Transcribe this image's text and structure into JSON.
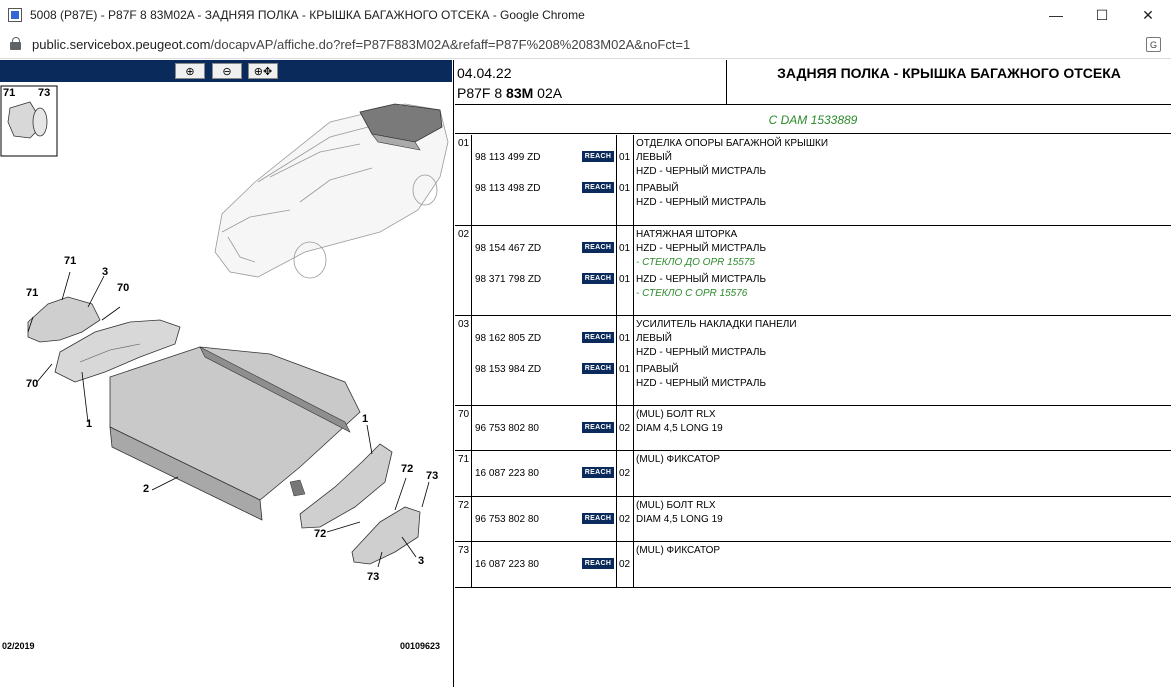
{
  "window": {
    "title": "5008 (P87E) - P87F 8 83M02A - ЗАДНЯЯ ПОЛКА - КРЫШКА БАГАЖНОГО ОТСЕКА - Google Chrome",
    "minimize": "—",
    "maximize": "☐",
    "close": "✕"
  },
  "address": {
    "host": "public.servicebox.peugeot.com",
    "path": "/docapvAP/affiche.do?ref=P87F883M02A&refaff=P87F%208%2083M02A&noFct=1"
  },
  "toolbar": {
    "zoom_in": "⊕",
    "zoom_out": "⊖",
    "zoom_fit": "⊕✥"
  },
  "diagram": {
    "callouts": {
      "c71a": "71",
      "c73a": "73",
      "c71b": "71",
      "c3a": "3",
      "c71c": "71",
      "c70a": "70",
      "c70b": "70",
      "c1a": "1",
      "c2": "2",
      "c1b": "1",
      "c72a": "72",
      "c73b": "73",
      "c72b": "72",
      "c73c": "73",
      "c3b": "3"
    },
    "footer_date": "02/2019",
    "footer_code": "00109623"
  },
  "header": {
    "date": "04.04.22",
    "ref_prefix": "P87F 8 ",
    "ref_bold": "83M",
    "ref_suffix": " 02A",
    "title": "ЗАДНЯЯ ПОЛКА - КРЫШКА БАГАЖНОГО ОТСЕКА",
    "dam": "С DAM 1533889"
  },
  "reach_label": "REACH",
  "groups": [
    {
      "num": "01",
      "title": "ОТДЕЛКА ОПОРЫ БАГАЖНОЙ КРЫШКИ",
      "lines": [
        {
          "ref": "98 113 499 ZD",
          "qty": "01",
          "t1": "ЛЕВЫЙ",
          "t2": "HZD - ЧЕРНЫЙ МИСТРАЛЬ",
          "t3": ""
        },
        {
          "ref": "98 113 498 ZD",
          "qty": "01",
          "t1": "ПРАВЫЙ",
          "t2": "HZD - ЧЕРНЫЙ МИСТРАЛЬ",
          "t3": ""
        }
      ]
    },
    {
      "num": "02",
      "title": "НАТЯЖНАЯ ШТОРКА",
      "lines": [
        {
          "ref": "98 154 467 ZD",
          "qty": "01",
          "t1": "HZD - ЧЕРНЫЙ МИСТРАЛЬ",
          "t2": "- СТЕКЛО ДО OPR 15575",
          "t3": ""
        },
        {
          "ref": "98 371 798 ZD",
          "qty": "01",
          "t1": "HZD - ЧЕРНЫЙ МИСТРАЛЬ",
          "t2": "- СТЕКЛО С OPR 15576",
          "t3": ""
        }
      ]
    },
    {
      "num": "03",
      "title": "УСИЛИТЕЛЬ НАКЛАДКИ ПАНЕЛИ",
      "lines": [
        {
          "ref": "98 162 805 ZD",
          "qty": "01",
          "t1": "ЛЕВЫЙ",
          "t2": "HZD - ЧЕРНЫЙ МИСТРАЛЬ",
          "t3": ""
        },
        {
          "ref": "98 153 984 ZD",
          "qty": "01",
          "t1": "ПРАВЫЙ",
          "t2": "HZD - ЧЕРНЫЙ МИСТРАЛЬ",
          "t3": ""
        }
      ]
    },
    {
      "num": "70",
      "title": "(MUL) БОЛТ RLX",
      "lines": [
        {
          "ref": "96 753 802 80",
          "qty": "02",
          "t1": "DIAM 4,5 LONG 19",
          "t2": "",
          "t3": ""
        }
      ]
    },
    {
      "num": "71",
      "title": "(MUL) ФИКСАТОР",
      "lines": [
        {
          "ref": "16 087 223 80",
          "qty": "02",
          "t1": "",
          "t2": "",
          "t3": ""
        }
      ]
    },
    {
      "num": "72",
      "title": "(MUL) БОЛТ RLX",
      "lines": [
        {
          "ref": "96 753 802 80",
          "qty": "02",
          "t1": "DIAM 4,5 LONG 19",
          "t2": "",
          "t3": ""
        }
      ]
    },
    {
      "num": "73",
      "title": "(MUL) ФИКСАТОР",
      "lines": [
        {
          "ref": "16 087 223 80",
          "qty": "02",
          "t1": "",
          "t2": "",
          "t3": ""
        }
      ]
    }
  ]
}
